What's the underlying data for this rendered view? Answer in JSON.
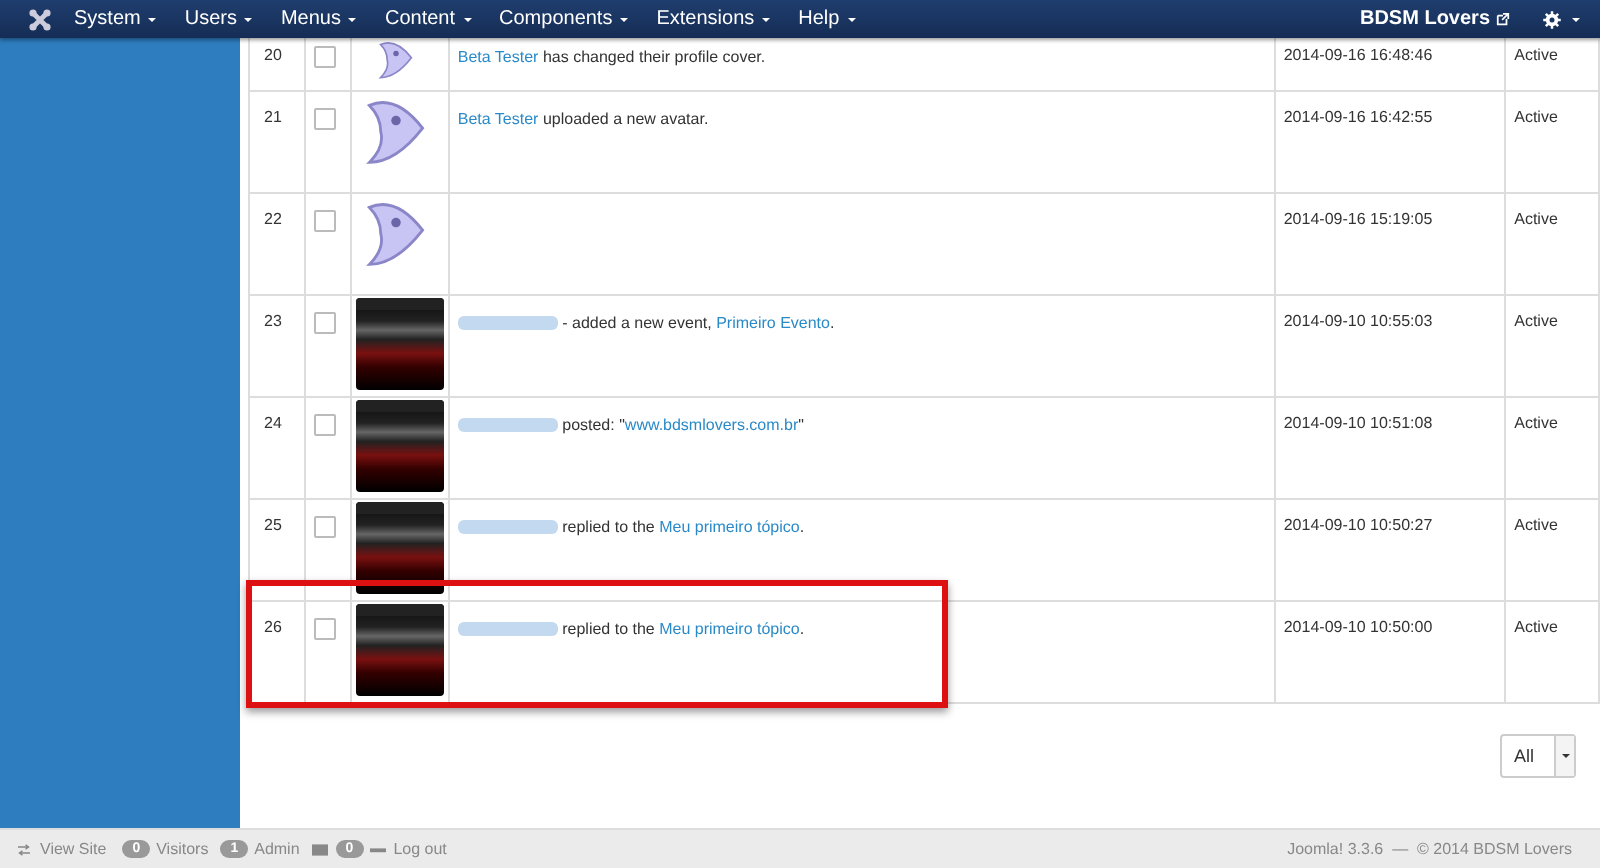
{
  "navbar": {
    "menus": [
      {
        "label": "System"
      },
      {
        "label": "Users"
      },
      {
        "label": "Menus"
      },
      {
        "label": "Content"
      },
      {
        "label": "Components"
      },
      {
        "label": "Extensions"
      },
      {
        "label": "Help"
      }
    ],
    "site_link": "BDSM Lovers"
  },
  "table": {
    "rows": [
      {
        "number": "20",
        "checked": false,
        "kind": "mascot",
        "parts": [
          {
            "kind": "link",
            "text": "Beta Tester"
          },
          {
            "kind": "text",
            "text": " has changed their profile cover."
          }
        ],
        "date": "2014-09-16 16:48:46",
        "status": "Active"
      },
      {
        "number": "21",
        "checked": false,
        "kind": "mascot",
        "parts": [
          {
            "kind": "link",
            "text": "Beta Tester"
          },
          {
            "kind": "text",
            "text": " uploaded a new avatar."
          }
        ],
        "date": "2014-09-16 16:42:55",
        "status": "Active"
      },
      {
        "number": "22",
        "checked": false,
        "kind": "mascot",
        "parts": [],
        "date": "2014-09-16 15:19:05",
        "status": "Active"
      },
      {
        "number": "23",
        "checked": false,
        "kind": "photo",
        "parts": [
          {
            "kind": "blurred"
          },
          {
            "kind": "text",
            "text": " - added a new event, "
          },
          {
            "kind": "link",
            "text": "Primeiro Evento"
          },
          {
            "kind": "text",
            "text": "."
          }
        ],
        "date": "2014-09-10 10:55:03",
        "status": "Active"
      },
      {
        "number": "24",
        "checked": false,
        "kind": "photo",
        "parts": [
          {
            "kind": "blurred"
          },
          {
            "kind": "text",
            "text": " posted: \""
          },
          {
            "kind": "link",
            "text": "www.bdsmlovers.com.br"
          },
          {
            "kind": "text",
            "text": "\""
          }
        ],
        "date": "2014-09-10 10:51:08",
        "status": "Active"
      },
      {
        "number": "25",
        "checked": false,
        "kind": "photo",
        "parts": [
          {
            "kind": "blurred"
          },
          {
            "kind": "text",
            "text": " replied to the "
          },
          {
            "kind": "link",
            "text": "Meu primeiro tópico"
          },
          {
            "kind": "text",
            "text": "."
          }
        ],
        "date": "2014-09-10 10:50:27",
        "status": "Active"
      },
      {
        "number": "26",
        "checked": false,
        "kind": "photo",
        "highlighted": true,
        "parts": [
          {
            "kind": "blurred"
          },
          {
            "kind": "text",
            "text": " replied to the "
          },
          {
            "kind": "link",
            "text": "Meu primeiro tópico"
          },
          {
            "kind": "text",
            "text": "."
          }
        ],
        "date": "2014-09-10 10:50:00",
        "status": "Active"
      }
    ]
  },
  "limit_select": {
    "value": "All"
  },
  "footer": {
    "view_site": "View Site",
    "visitors_count": "0",
    "visitors_label": "Visitors",
    "admin_count": "1",
    "admin_label": "Admin",
    "messages_count": "0",
    "logout": "Log out",
    "version": "Joomla! 3.3.6  —  © 2014 BDSM Lovers"
  }
}
